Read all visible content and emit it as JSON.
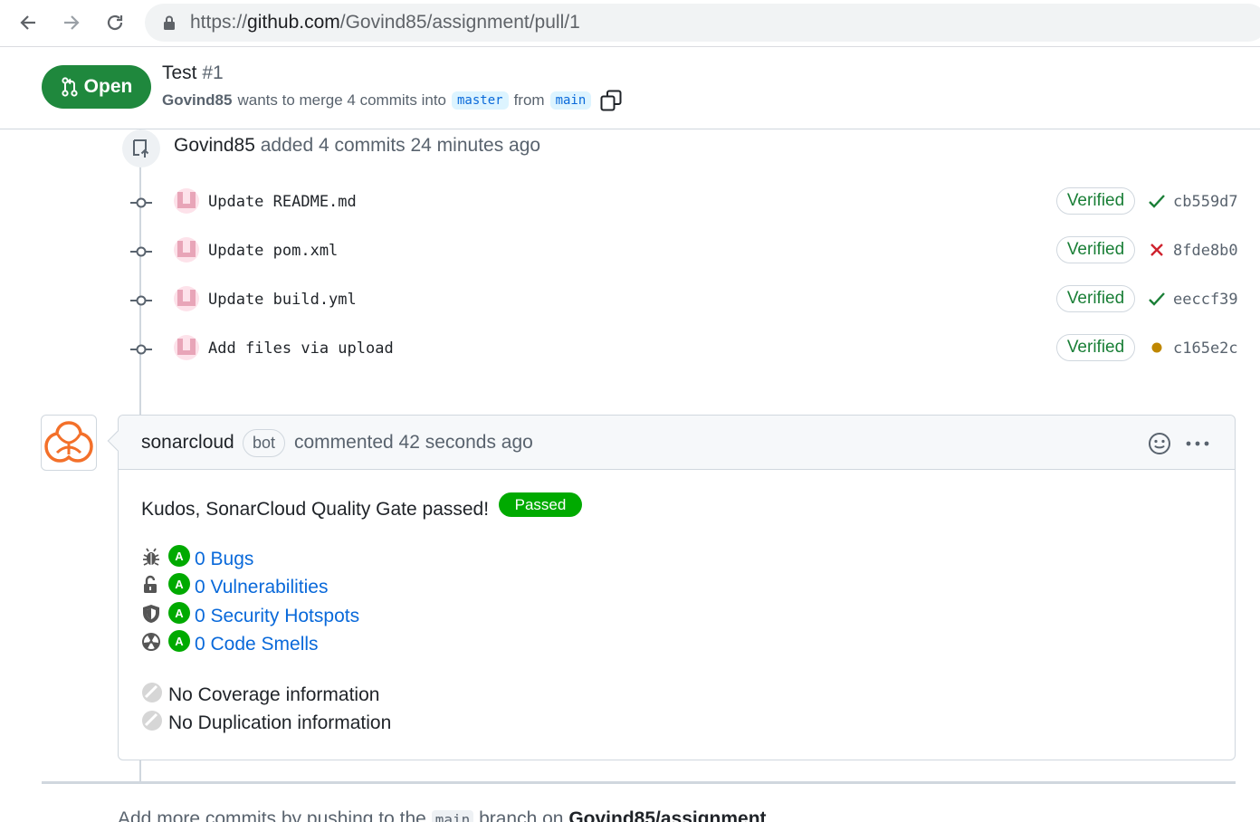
{
  "browser": {
    "url_prefix": "https://",
    "url_host": "github.com",
    "url_path": "/Govind85/assignment/pull/1"
  },
  "pr": {
    "state_label": "Open",
    "title": "Test",
    "number": "#1",
    "author": "Govind85",
    "merge_text": "wants to merge 4 commits into",
    "base_branch": "master",
    "from_text": "from",
    "head_branch": "main"
  },
  "push_event": {
    "actor": "Govind85",
    "text": "added 4 commits 24 minutes ago"
  },
  "commits": [
    {
      "message": "Update README.md",
      "badge": "Verified",
      "status": "success",
      "status_icon": "check-icon",
      "sha": "cb559d7"
    },
    {
      "message": "Update pom.xml",
      "badge": "Verified",
      "status": "failure",
      "status_icon": "x-icon",
      "sha": "8fde8b0"
    },
    {
      "message": "Update build.yml",
      "badge": "Verified",
      "status": "success",
      "status_icon": "check-icon",
      "sha": "eeccf39"
    },
    {
      "message": "Add files via upload",
      "badge": "Verified",
      "status": "pending",
      "status_icon": "dot-icon",
      "sha": "c165e2c"
    }
  ],
  "comment": {
    "author": "sonarcloud",
    "author_badge": "bot",
    "timestamp": "commented 42 seconds ago",
    "kudos": "Kudos, SonarCloud Quality Gate passed!",
    "gate_label": "Passed",
    "metrics": [
      {
        "icon": "bug-icon",
        "grade": "A",
        "label": "0 Bugs"
      },
      {
        "icon": "unlocked-icon",
        "grade": "A",
        "label": "0 Vulnerabilities"
      },
      {
        "icon": "shield-icon",
        "grade": "A",
        "label": "0 Security Hotspots"
      },
      {
        "icon": "radiation-icon",
        "grade": "A",
        "label": "0 Code Smells"
      }
    ],
    "coverage": "No Coverage information",
    "duplication": "No Duplication information"
  },
  "footer": {
    "text_before": "Add more commits by pushing to the",
    "branch": "main",
    "text_middle": "branch on",
    "repo": "Govind85/assignment"
  },
  "colors": {
    "open_green": "#1f883d",
    "verified_green": "#1a7f37",
    "failure_red": "#cf222e",
    "pending_yellow": "#bf8700",
    "sonar_green": "#00aa00",
    "link_blue": "#0969da"
  }
}
